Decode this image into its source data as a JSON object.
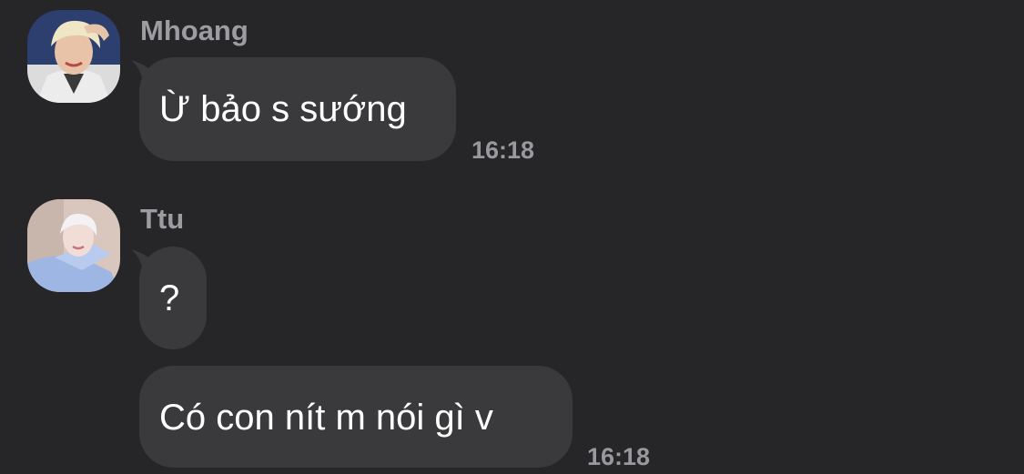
{
  "colors": {
    "background": "#262628",
    "bubble": "#3a3a3c",
    "sender_name": "#9c9ca1",
    "timestamp": "#98989d",
    "message_text": "#ffffff"
  },
  "messages": [
    {
      "sender": "Mhoang",
      "avatar_icon": "person-avatar-blonde-white-jacket",
      "bubbles": [
        {
          "text": "Ừ bảo s sướng"
        }
      ],
      "time": "16:18"
    },
    {
      "sender": "Ttu",
      "avatar_icon": "person-avatar-blonde-blue-shirt",
      "bubbles": [
        {
          "text": "?"
        },
        {
          "text": "Có con nít m nói gì v"
        }
      ],
      "time": "16:18"
    }
  ]
}
